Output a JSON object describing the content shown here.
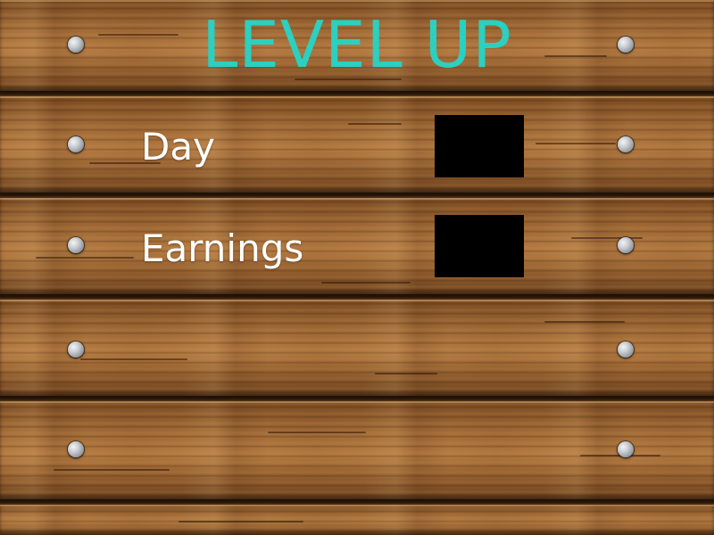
{
  "title": "LEVEL UP",
  "stats": {
    "day_label": "Day",
    "day_value": "",
    "earnings_label": "Earnings",
    "earnings_value": ""
  },
  "colors": {
    "title": "#2bd0c0",
    "label": "#ffffff",
    "value_box": "#000000",
    "wood": "#8a5a2e"
  }
}
